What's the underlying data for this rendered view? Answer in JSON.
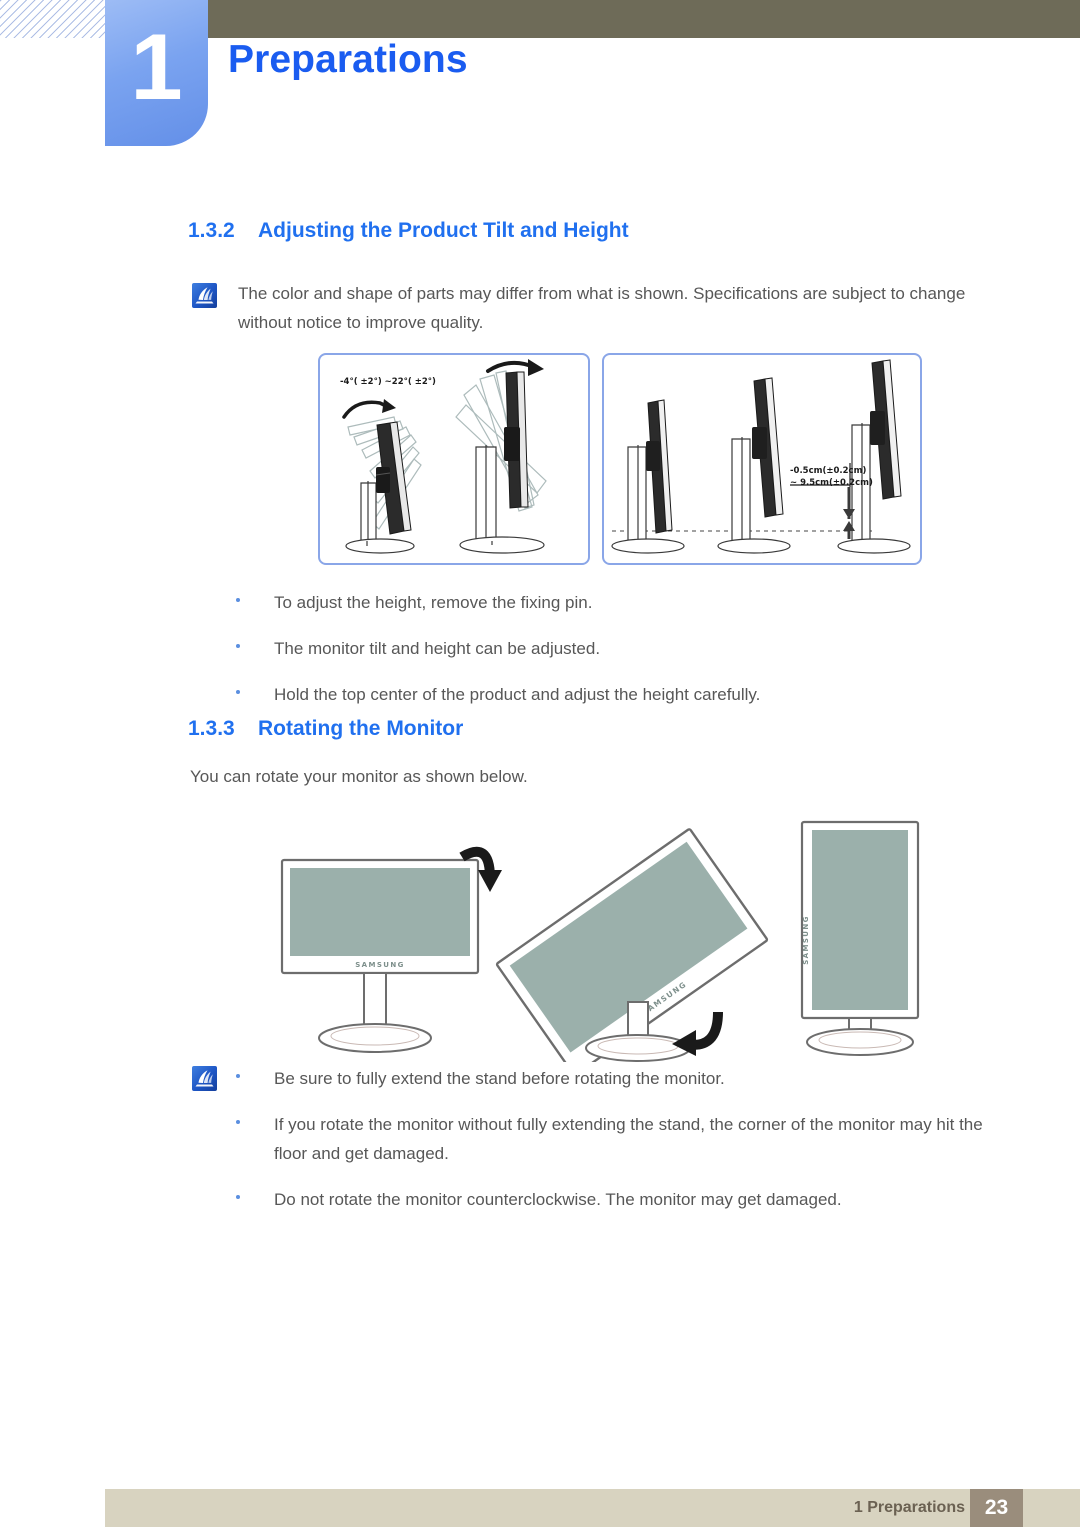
{
  "header": {
    "chapter_number": "1",
    "chapter_title": "Preparations",
    "accent_blue": "#1a5cf0",
    "tab_blue": "#7aa3f0",
    "olive": "#6e6b58"
  },
  "sections": [
    {
      "number": "1.3.2",
      "title": "Adjusting the Product Tilt and Height",
      "note": "The color and shape of parts may differ from what is shown. Specifications are subject to change without notice to improve quality.",
      "bullets": [
        "To adjust the height, remove the fixing pin.",
        "The monitor tilt and height can be adjusted.",
        "Hold the top center of the product and adjust the height carefully."
      ]
    },
    {
      "number": "1.3.3",
      "title": "Rotating the Monitor",
      "intro": "You can rotate your monitor as shown below.",
      "bullets": [
        "Be sure to fully extend the stand before rotating the monitor.",
        "If you rotate the monitor without fully extending the stand, the corner of the monitor may hit the floor and get damaged.",
        "Do not rotate the monitor counterclockwise. The monitor may get damaged."
      ]
    }
  ],
  "figures": {
    "tilt_panel": {
      "angle_label": "-4°( ±2°) ~22°( ±2°)"
    },
    "height_panel": {
      "height_label_line1": "-0.5cm(±0.2cm)",
      "height_label_line2": "~ 9.5cm(±0.2cm)"
    },
    "rotation": {
      "brand": "SAMSUNG"
    }
  },
  "footer": {
    "label": "1 Preparations",
    "page_number": "23",
    "bar_color": "#d8d3c0",
    "page_box_color": "#9a8d7c"
  }
}
